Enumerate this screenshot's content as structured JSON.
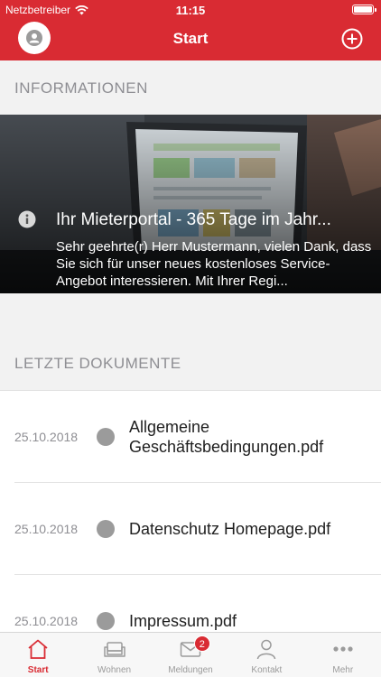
{
  "status_bar": {
    "carrier": "Netzbetreiber",
    "time": "11:15"
  },
  "nav": {
    "title": "Start"
  },
  "sections": {
    "info": "INFORMATIONEN",
    "docs": "LETZTE DOKUMENTE"
  },
  "hero": {
    "title": "Ihr Mieterportal - 365 Tage im Jahr...",
    "text": "Sehr geehrte(r) Herr Mustermann, vielen Dank, dass Sie sich für unser neues kostenloses Service-Angebot interessieren. Mit Ihrer Regi..."
  },
  "documents": [
    {
      "date": "25.10.2018",
      "name": "Allgemeine Geschäftsbedingungen.pdf"
    },
    {
      "date": "25.10.2018",
      "name": "Datenschutz Homepage.pdf"
    },
    {
      "date": "25.10.2018",
      "name": "Impressum.pdf"
    }
  ],
  "tabs": [
    {
      "label": "Start",
      "icon": "home-icon",
      "active": true
    },
    {
      "label": "Wohnen",
      "icon": "sofa-icon"
    },
    {
      "label": "Meldungen",
      "icon": "mail-icon",
      "badge": "2"
    },
    {
      "label": "Kontakt",
      "icon": "person-icon"
    },
    {
      "label": "Mehr",
      "icon": "more-icon"
    }
  ],
  "colors": {
    "accent": "#d92b33",
    "inactive": "#9b9b9b",
    "background": "#f2f2f2"
  }
}
